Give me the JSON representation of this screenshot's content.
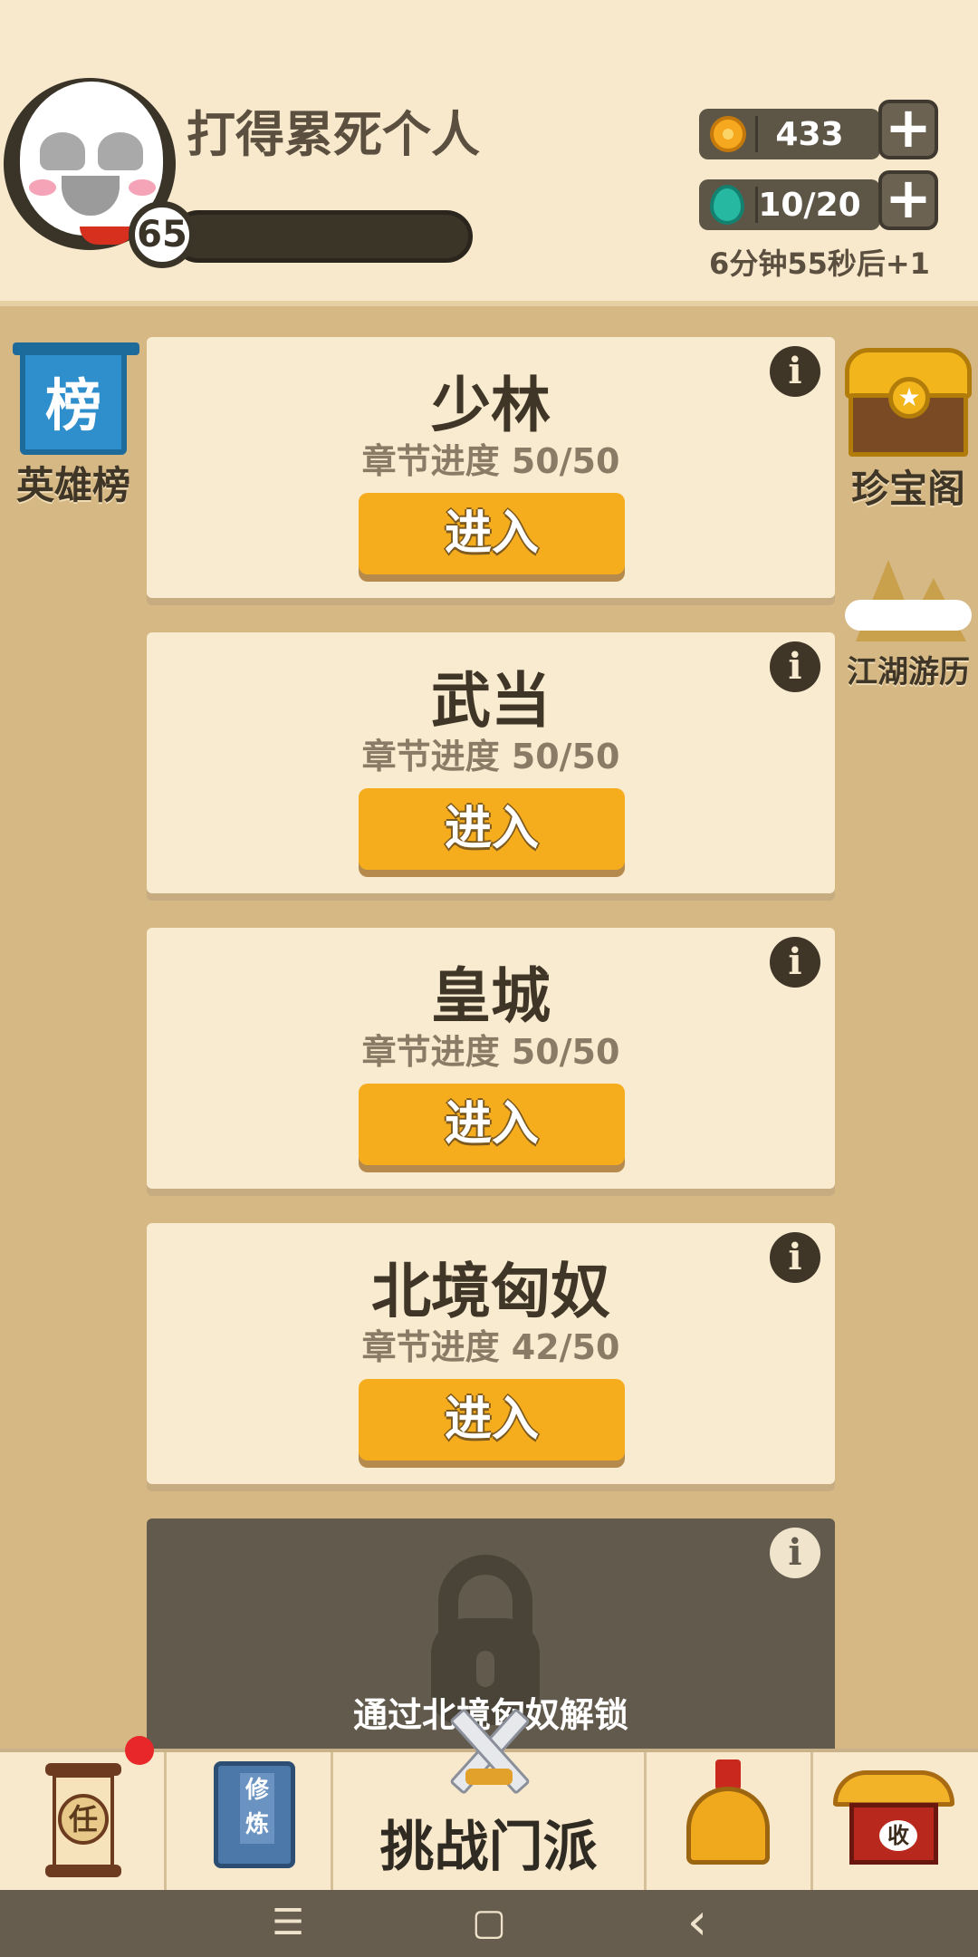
{
  "player": {
    "name": "打得累死个人",
    "level": "65",
    "exp_fraction": 0
  },
  "resources": {
    "coins": "433",
    "stamina": "10/20",
    "regen_text": "6分钟55秒后+1",
    "plus_symbol": "+"
  },
  "left_side": {
    "ranking_icon_text": "榜",
    "ranking_label": "英雄榜"
  },
  "right_side": {
    "treasure_label": "珍宝阁",
    "treasure_icon_text": "★",
    "jianghu_label": "江湖游历"
  },
  "sects": [
    {
      "name": "少林",
      "progress": "章节进度 50/50",
      "button": "进入",
      "info": "i"
    },
    {
      "name": "武当",
      "progress": "章节进度 50/50",
      "button": "进入",
      "info": "i"
    },
    {
      "name": "皇城",
      "progress": "章节进度 50/50",
      "button": "进入",
      "info": "i"
    },
    {
      "name": "北境匈奴",
      "progress": "章节进度 42/50",
      "button": "进入",
      "info": "i"
    }
  ],
  "locked_sect": {
    "unlock_text": "通过北境匈奴解锁",
    "info": "i"
  },
  "bottom_nav": {
    "task_icon_text": "任",
    "cultivate_icon_text": "修炼",
    "center_label": "挑战门派",
    "collect_icon_text": "收"
  },
  "system_nav": {
    "menu_symbol": "☰",
    "home_symbol": "▢",
    "back_symbol": "‹"
  },
  "colors": {
    "accent_button": "#f6ad1d",
    "card_bg": "#f9ebcf",
    "locked_card_bg": "#625a4d",
    "page_bg": "#d6b885",
    "notification_dot": "#e8272a"
  }
}
